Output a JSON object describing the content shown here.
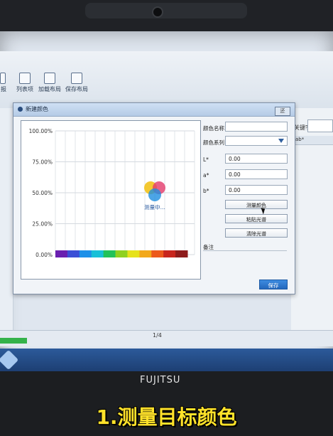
{
  "toolbar": {
    "left_cut_label": "报",
    "buttons": [
      {
        "label": "列表项",
        "icon": "list-icon"
      },
      {
        "label": "加载布局",
        "icon": "load-layout-icon"
      },
      {
        "label": "保存布局",
        "icon": "save-layout-icon"
      }
    ]
  },
  "right_panel": {
    "keyword_label": "关键字",
    "header": "ab*"
  },
  "dialog": {
    "title": "新建颜色",
    "close_label": "还",
    "form": {
      "name_label": "颜色名称",
      "series_label": "颜色系列",
      "l_label": "L*",
      "l_value": "0.00",
      "a_label": "a*",
      "a_value": "0.00",
      "b_label": "b*",
      "b_value": "0.00",
      "measure_button": "测量颜色",
      "paste_button": "粘贴光谱",
      "clear_button": "清除光谱",
      "remark_label": "备注",
      "save_button": "保存"
    }
  },
  "chart_data": {
    "type": "line",
    "yticks": [
      "100.00%",
      "75.00%",
      "50.00%",
      "25.00%",
      "0.00%"
    ],
    "ylim": [
      0,
      100
    ],
    "grid": true,
    "series": [],
    "annotations": [
      "测量中..."
    ],
    "spectrum_bar": [
      "#6a1fb0",
      "#3b4fd6",
      "#1e90e8",
      "#18c0d8",
      "#22c25a",
      "#8fd11f",
      "#e6e21a",
      "#f2a81a",
      "#ec5a1c",
      "#c8261e",
      "#8e1c1c"
    ]
  },
  "status": {
    "page": "1/4",
    "progress": 0.08
  },
  "bezel": {
    "brand": "FUJITSU"
  },
  "caption": "1.测量目标颜色",
  "colors": {
    "accent": "#2468bd",
    "caption": "#ffe22a"
  }
}
